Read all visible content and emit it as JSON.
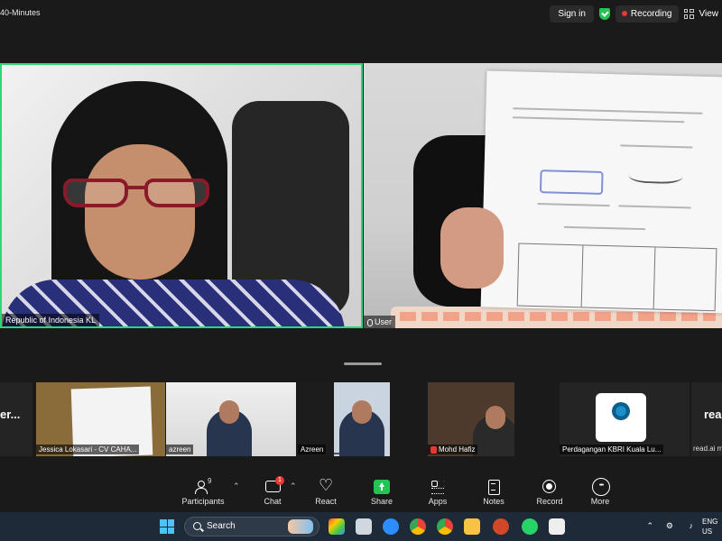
{
  "topbar": {
    "timer_text": "40-Minutes",
    "signin_label": "Sign in",
    "recording_label": "Recording",
    "view_label": "View",
    "colors": {
      "secure": "#23c552",
      "recording": "#e53935"
    }
  },
  "main_tiles": [
    {
      "label": "Republic of Indonesia KL",
      "active_speaker": true
    },
    {
      "label": "User"
    }
  ],
  "gallery": [
    {
      "big_text": "er...",
      "sub": ""
    },
    {
      "label": "Jessica Lokasari - CV CAHA..."
    },
    {
      "label": "azreen"
    },
    {
      "label": "Azreen"
    },
    {
      "label": ""
    },
    {
      "label": "Mohd Hafiz"
    },
    {
      "label": "Perdagangan KBRI Kuala Lu..."
    },
    {
      "big_text": "rea",
      "sub": "read.ai m"
    }
  ],
  "toolbar": {
    "participants": {
      "label": "Participants",
      "count": "9",
      "icon": "people-icon"
    },
    "chat": {
      "label": "Chat",
      "badge": "1",
      "icon": "chat-icon"
    },
    "react": {
      "label": "React",
      "icon": "heart-icon"
    },
    "share": {
      "label": "Share",
      "icon": "share-icon"
    },
    "apps": {
      "label": "Apps",
      "icon": "apps-icon"
    },
    "notes": {
      "label": "Notes",
      "icon": "notes-icon"
    },
    "record": {
      "label": "Record",
      "icon": "record-icon"
    },
    "more": {
      "label": "More",
      "icon": "more-icon"
    }
  },
  "taskbar": {
    "search_placeholder": "Search",
    "lang_top": "ENG",
    "lang_bottom": "US"
  }
}
